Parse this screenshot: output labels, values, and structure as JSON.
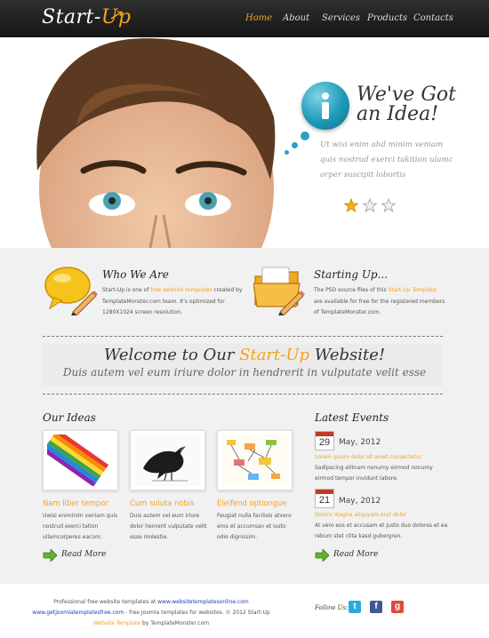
{
  "header": {
    "logo_main": "Start-",
    "logo_accent": "Up",
    "nav": [
      {
        "label": "Home",
        "active": true
      },
      {
        "label": "About",
        "active": false
      },
      {
        "label": "Services",
        "active": false
      },
      {
        "label": "Products",
        "active": false
      },
      {
        "label": "Contacts",
        "active": false
      }
    ]
  },
  "hero": {
    "title_line1": "We've Got",
    "title_line2": "an Idea!",
    "text": "Ut wisi enim ahd minim veniam quis nostrud exerci takition ulamc orper suscipit lobortis",
    "rating": {
      "filled": 1,
      "total": 3
    }
  },
  "about": [
    {
      "title": "Who We Are",
      "text_before": "Start-Up is one of ",
      "highlight": "free website templates",
      "text_after": " created by TemplateMonster.com team. It's optimized for 1280X1024 screen resolution."
    },
    {
      "title": "Starting Up...",
      "text_before": "The PSD source files of this ",
      "highlight": "Start-Up Template",
      "text_after": " are available for free for the registered members of TemplateMonster.com."
    }
  ],
  "welcome": {
    "title_before": "Welcome to Our ",
    "title_accent": "Start-Up",
    "title_after": " Website!",
    "subtitle": "Duis autem vel eum iriure dolor in hendrerit in vulputate velit esse"
  },
  "ideas": {
    "heading": "Our Ideas",
    "items": [
      {
        "title": "Nam liber tempor",
        "text": "Uwisi eniminim veniam quis nostrud exerci tation ullamcorperes eacom."
      },
      {
        "title": "Cum soluta nobis",
        "text": "Duis autem vel eum iriure dolor henrerit vulputate velit esse molestie."
      },
      {
        "title": "Eleifend optiongue",
        "text": "Feugiat nulla facilisis atvero eros et accumsan et iusto odio dignissim."
      }
    ],
    "read_more": "Read More"
  },
  "events": {
    "heading": "Latest Events",
    "items": [
      {
        "day": "29",
        "date": "May, 2012",
        "title": "Lorem ipsum dolor sit amet consectetur",
        "text": "Sadipscing elitnam nonumy eirmod nonumy eirmod tempor invidunt labore."
      },
      {
        "day": "21",
        "date": "May, 2012",
        "title": "Dolore magna aliquyam erat dolor",
        "text": "At vero eos et accusam et justo duo dolores et ea rebum stet clita kasd gubergren."
      }
    ],
    "read_more": "Read More"
  },
  "footer": {
    "line1_text": "Professional free website templates at ",
    "line1_link": "www.websitetemplatesonline.com",
    "line2_link": "www.getjoomlatemplatesfree.com",
    "line2_text": " - free Joomla templates for websites. © 2012 Start-Up",
    "line3_link": "Website Template",
    "line3_text": " by TemplateMonster.com",
    "follow": "Follow Us:",
    "social": [
      {
        "icon": "twitter-icon",
        "glyph": "t",
        "color": "#2aa9e0"
      },
      {
        "icon": "facebook-icon",
        "glyph": "f",
        "color": "#3b5998"
      },
      {
        "icon": "google-icon",
        "glyph": "g",
        "color": "#dd4b39"
      }
    ]
  },
  "colors": {
    "accent": "#f7a21b",
    "header_bg": "#1f1f1f",
    "content_bg": "#f1f1f1"
  }
}
